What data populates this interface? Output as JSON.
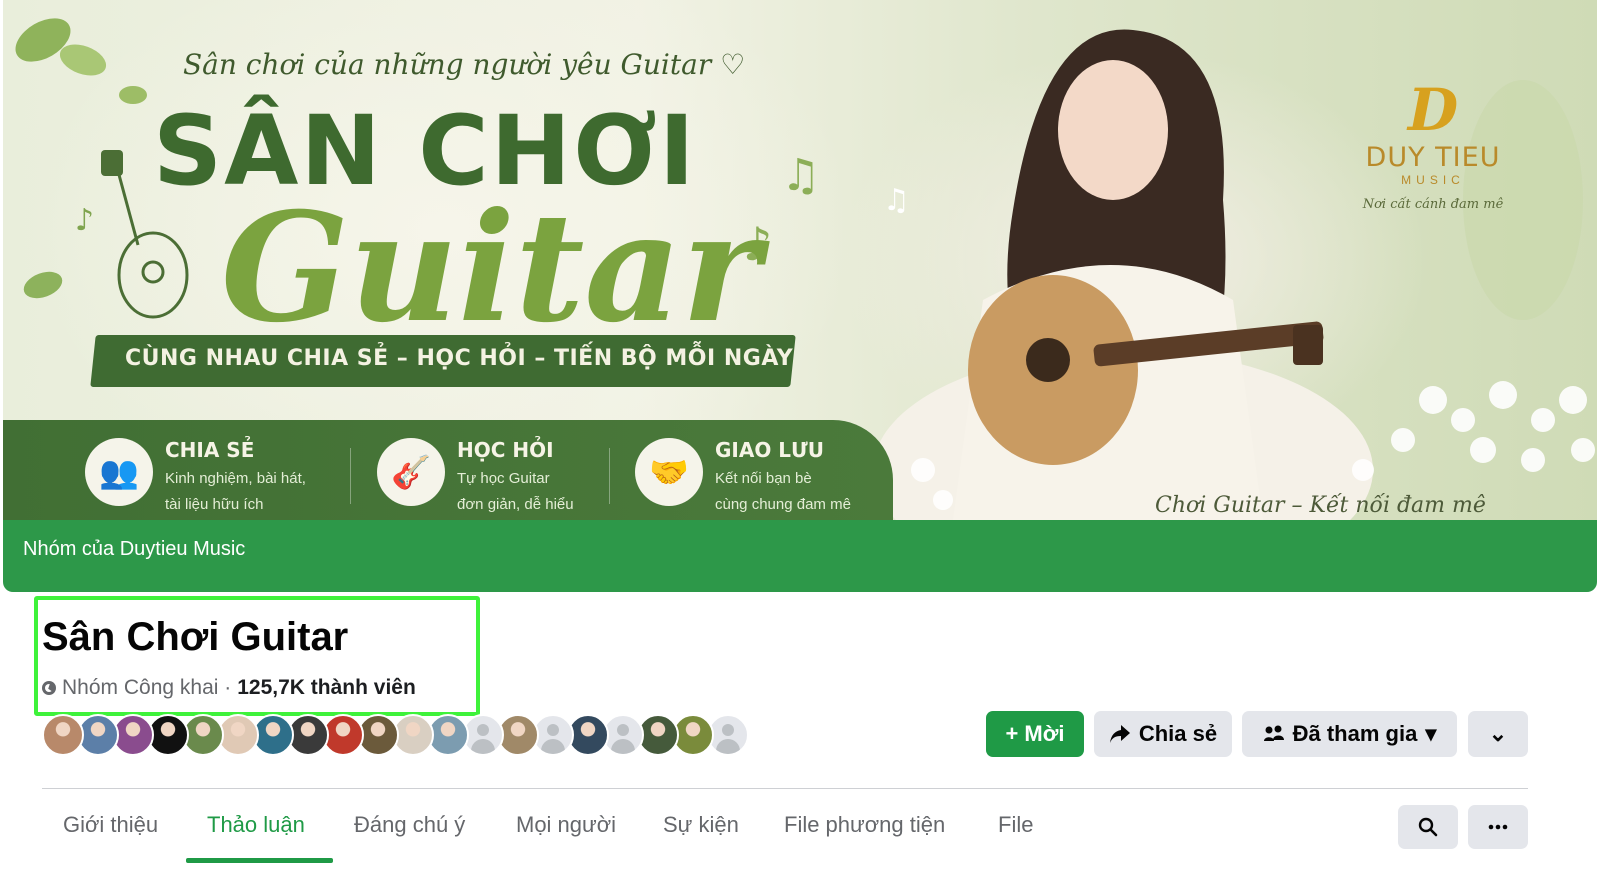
{
  "cover": {
    "tagline": "Sân chơi của những người yêu Guitar ♡",
    "title": "SÂN CHƠI",
    "script_title": "Guitar",
    "motto": "CÙNG NHAU CHIA SẺ – HỌC HỎI – TIẾN BỘ MỖI NGÀY",
    "features": [
      {
        "title": "CHIA SẺ",
        "line1": "Kinh nghiệm, bài hát,",
        "line2": "tài liệu hữu ích",
        "icon": "people-icon"
      },
      {
        "title": "HỌC HỎI",
        "line1": "Tự học Guitar",
        "line2": "đơn giản, dễ hiểu",
        "icon": "guitar-icon"
      },
      {
        "title": "GIAO LƯU",
        "line1": "Kết nối bạn bè",
        "line2": "cùng chung đam mê",
        "icon": "handshake-icon"
      }
    ],
    "brand": {
      "logo": "D",
      "name": "DUY TIEU",
      "sub": "MUSIC",
      "slogan": "Nơi cất cánh đam mê"
    },
    "bottom_script": "Chơi Guitar – Kết nối đam mê",
    "owner_strip": "Nhóm của Duytieu Music"
  },
  "group": {
    "name": "Sân Chơi Guitar",
    "privacy": "Nhóm Công khai ·",
    "members": "125,7K thành viên"
  },
  "member_avatars": [
    "#b8896a",
    "#5c7fa8",
    "#8a4c8e",
    "#111111",
    "#6a8a4c",
    "#e0c9b5",
    "#2e6f8a",
    "#3a3a3a",
    "#c0392b",
    "#6b5a3b",
    "#d9cfc2",
    "#7c9cb0",
    "default",
    "#a08968",
    "default",
    "#33495e",
    "default",
    "#455a3b",
    "#7a8b3b",
    "default"
  ],
  "actions": {
    "invite": "+ Mời",
    "share": "Chia sẻ",
    "joined": "Đã tham gia",
    "joined_caret": "▾",
    "more": "⌄"
  },
  "tabs": [
    "Giới thiệu",
    "Thảo luận",
    "Đáng chú ý",
    "Mọi người",
    "Sự kiện",
    "File phương tiện",
    "File"
  ],
  "active_tab": "Thảo luận",
  "colors": {
    "accent": "#1f9a46",
    "cover_strip": "#2d9849",
    "highlight_box": "#3ef23a"
  }
}
